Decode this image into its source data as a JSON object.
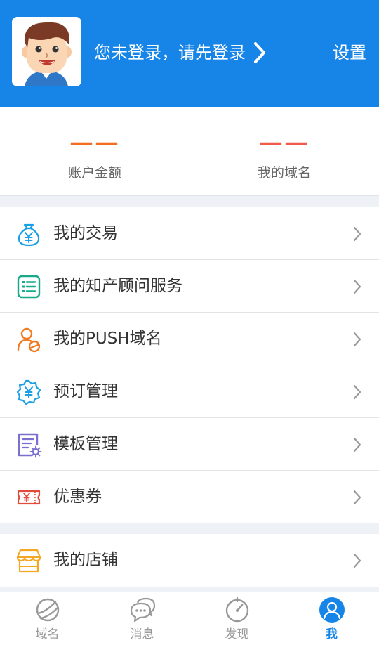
{
  "header": {
    "login_prompt": "您未登录，请先登录",
    "settings_label": "设置",
    "background_color": "#1785e8"
  },
  "stats": {
    "balance": {
      "value": "——",
      "label": "账户金额",
      "color": "#f26d21"
    },
    "domains": {
      "value": "——",
      "label": "我的域名",
      "color": "#ef5a4a"
    }
  },
  "menu": {
    "items": [
      {
        "label": "我的交易",
        "icon": "money-bag-yen-icon",
        "color": "#1aa0e6"
      },
      {
        "label": "我的知产顾问服务",
        "icon": "list-document-icon",
        "color": "#17a98a"
      },
      {
        "label": "我的PUSH域名",
        "icon": "user-push-icon",
        "color": "#f07b22"
      },
      {
        "label": "预订管理",
        "icon": "yen-badge-icon",
        "color": "#1aa0e6"
      },
      {
        "label": "模板管理",
        "icon": "template-settings-icon",
        "color": "#7b6fd0"
      },
      {
        "label": "优惠券",
        "icon": "coupon-ticket-icon",
        "color": "#e14b3b"
      },
      {
        "label": "我的店铺",
        "icon": "store-icon",
        "color": "#f5a623"
      }
    ]
  },
  "tabbar": {
    "tabs": [
      {
        "label": "域名",
        "icon": "planet-icon",
        "active": false
      },
      {
        "label": "消息",
        "icon": "chat-bubbles-icon",
        "active": false
      },
      {
        "label": "发现",
        "icon": "compass-icon",
        "active": false
      },
      {
        "label": "我",
        "icon": "person-icon",
        "active": true
      }
    ],
    "active_color": "#1785e8",
    "inactive_color": "#999999"
  }
}
